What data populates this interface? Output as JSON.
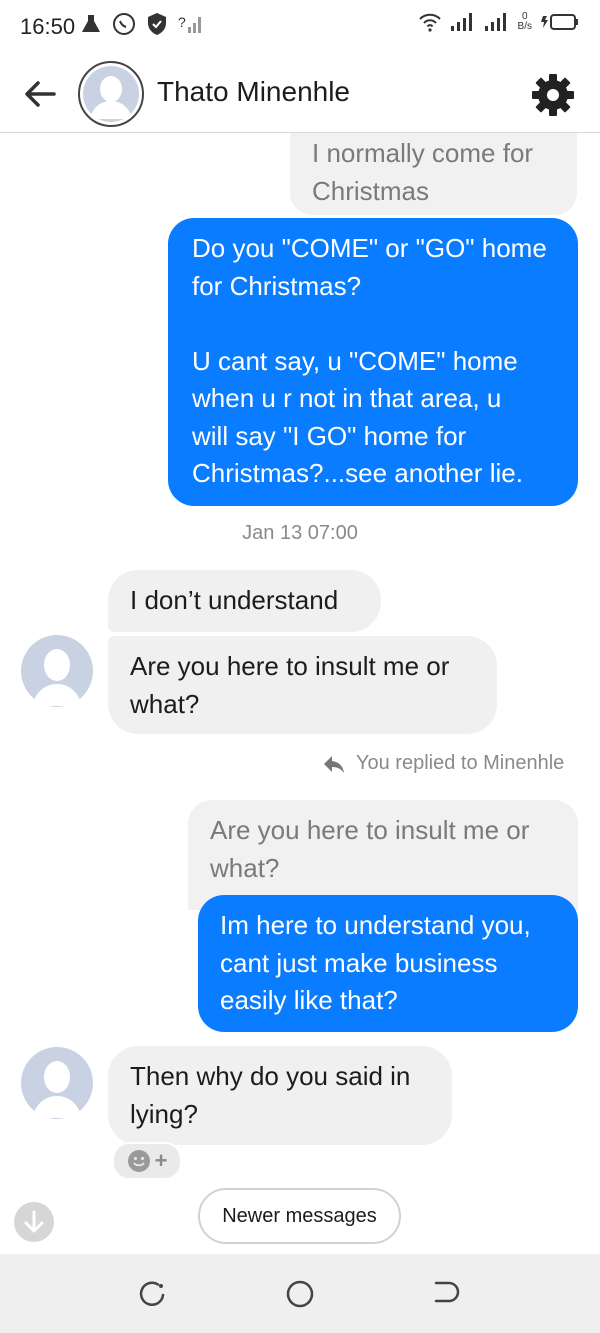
{
  "status_bar": {
    "time": "16:50",
    "net_speed_value": "0",
    "net_speed_unit": "B/s"
  },
  "header": {
    "contact_name": "Thato Minenhle"
  },
  "messages": {
    "m1_quote": "I normally come for\nChristmas",
    "m2_out": "Do you \"COME\" or \"GO\" home\nfor Christmas?\n\nU cant say, u \"COME\" home\nwhen u r not in that area, u\nwill say \"I GO\" home for\nChristmas?...see another lie.",
    "timestamp": "Jan 13 07:00",
    "m3_in": "I don’t understand",
    "m4_in": "Are you here to insult me or\nwhat?",
    "replied_note": "You replied to Minenhle",
    "m5_quote": "Are you here to insult me or\nwhat?",
    "m6_out": "Im here to understand you,\ncant just make business\neasily like that?",
    "m7_in": "Then why do you said in\nlying?"
  },
  "controls": {
    "newer_messages_label": "Newer messages",
    "reaction_plus": "+"
  },
  "colors": {
    "outgoing_bubble": "#0a7cff",
    "incoming_bubble": "#f0f0f0",
    "quote_bubble": "#f1f1f1"
  },
  "icons": [
    "back-arrow-icon",
    "gear-icon",
    "avatar-placeholder-icon",
    "reply-arrow-icon",
    "smiley-icon",
    "down-arrow-icon",
    "recents-icon",
    "home-icon",
    "back-nav-icon"
  ]
}
